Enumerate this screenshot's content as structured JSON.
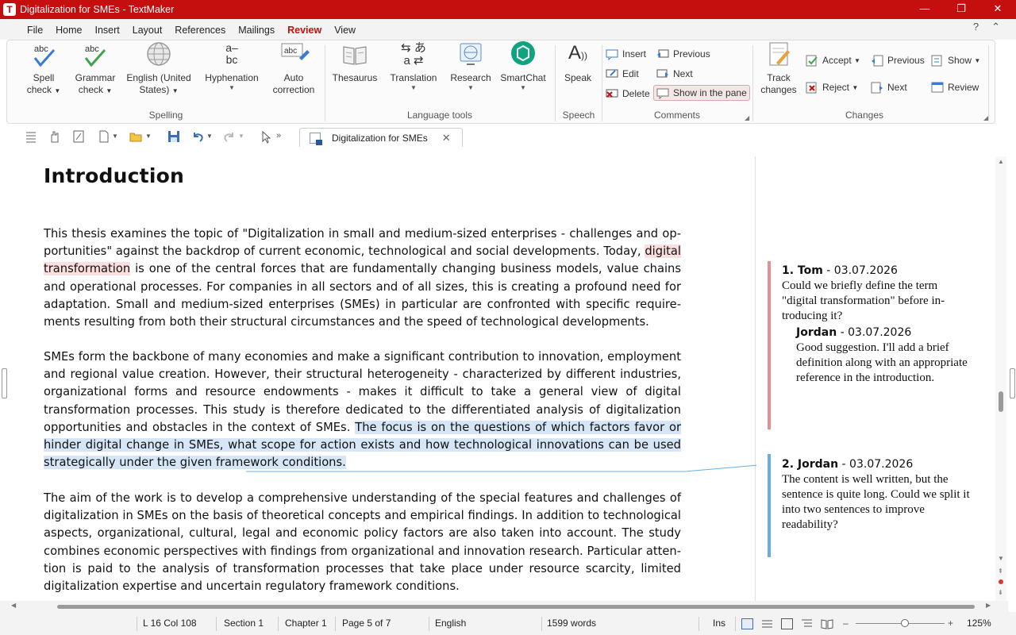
{
  "window": {
    "title": "Digitalization for SMEs - TextMaker",
    "app_icon": "T",
    "minimize": "—",
    "maximize": "❐",
    "close": "✕"
  },
  "menu": {
    "items": [
      "File",
      "Home",
      "Insert",
      "Layout",
      "References",
      "Mailings",
      "Review",
      "View"
    ],
    "active": "Review",
    "help": "?",
    "collapse": "⌃"
  },
  "ribbon": {
    "spelling": {
      "label": "Spelling",
      "spell_check": [
        "Spell",
        "check"
      ],
      "grammar_check": [
        "Grammar",
        "check"
      ],
      "language": [
        "English (United",
        "States)"
      ],
      "hyphenation": "Hyphenation",
      "auto_correction": [
        "Auto",
        "correction"
      ],
      "icon_text_abc": "abc",
      "hyphen_icon": "a–\nbc"
    },
    "language_tools": {
      "label": "Language tools",
      "thesaurus": "Thesaurus",
      "translation": "Translation",
      "research": "Research",
      "smartchat": "SmartChat"
    },
    "speech": {
      "label": "Speech",
      "speak": "Speak"
    },
    "comments": {
      "label": "Comments",
      "insert": "Insert",
      "edit": "Edit",
      "delete": "Delete",
      "previous": "Previous",
      "next": "Next",
      "show_in_pane": "Show in the pane"
    },
    "changes": {
      "label": "Changes",
      "track_changes": [
        "Track",
        "changes"
      ],
      "accept": "Accept",
      "reject": "Reject",
      "previous": "Previous",
      "next": "Next",
      "show": "Show",
      "review": "Review"
    }
  },
  "document_tab": {
    "label": "Digitalization for SMEs",
    "close": "✕"
  },
  "document": {
    "heading": "Introduction",
    "p1_before": "This thesis examines the topic of \"Digitalization in small and medium-sized enterprises - challenges and op­portunities\" against the backdrop of current economic, technological and social developments. Today, ",
    "p1_highlight": "digital transformation",
    "p1_after": " is one of the central forces that are fundamentally changing business models, value chains and operational processes. For companies in all sectors and of all sizes, this is creating a profound need for adaptation. Small and medium-sized enterprises (SMEs) in particular are confronted with specific require­ments resulting from both their structural circumstances and the speed of technological developments.",
    "p2_before": "SMEs form the backbone of many economies and make a significant contribution to innovation, employment and regional value creation. However, their structural heterogeneity - characterized by different industries, or­ganizational forms and resource endowments - makes it difficult to take a general view of digital transforma­tion processes. This study is therefore dedicated to the differentiated analysis of digitalization opportunities and obstacles in the context of SMEs. ",
    "p2_selected": "The focus is on the questions of which factors favor or hinder digital change in SMEs, what scope for action exists and how technological innovations can be used strategically un­der the given framework conditions.",
    "p3": "The aim of the work is to develop a comprehensive understanding of the special features and challenges of digitalization in SMEs on the basis of theoretical concepts and empirical findings. In addition to technological aspects, organizational, cultural, legal and economic policy factors are also taken into account. The study combines economic perspectives with findings from organizational and innovation research. Particular atten­tion is paid to the analysis of transformation processes that take place under resource scarcity, limited digital­ization expertise and uncertain regulatory framework conditions."
  },
  "comments": [
    {
      "number_author": "1. Tom",
      "date": " - 03.07.2026",
      "text": "Could we briefly define the term \"digital transformation\" before in­troducing it?",
      "color": "#e48f95",
      "reply": {
        "author": "Jordan",
        "date": " - 03.07.2026",
        "text": "Good suggestion. I'll add a brief definition along with an appro­priate reference in the introduc­tion."
      }
    },
    {
      "number_author": "2. Jordan",
      "date": " - 03.07.2026",
      "text": "The content is well written, but the sentence is quite long. Could we split it into two sentences to impro­ve readability?",
      "color": "#6aaee0"
    }
  ],
  "status": {
    "position": "L 16 Col 108",
    "section": "Section 1",
    "chapter": "Chapter 1",
    "page": "Page 5 of 7",
    "language": "English",
    "words": "1599 words",
    "mode": "Ins",
    "zoom": "125%",
    "zoom_minus": "–",
    "zoom_plus": "+",
    "zoom_level_fraction": 0.55
  },
  "colors": {
    "titlebar": "#c50f0f",
    "active_menu": "#c50f0f",
    "comment_highlight": "#fbdede",
    "selection": "#d6e6f6"
  }
}
